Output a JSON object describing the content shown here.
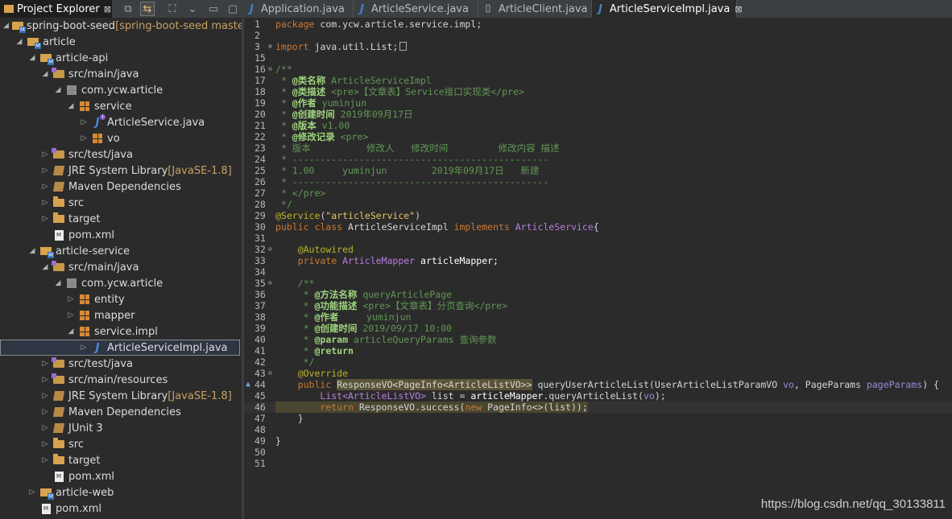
{
  "explorer": {
    "title": "Project Explorer",
    "close": "⊠"
  },
  "tabs": [
    {
      "label": "Application.java",
      "active": false
    },
    {
      "label": "ArticleService.java",
      "active": false
    },
    {
      "label": "ArticleClient.java",
      "active": false
    },
    {
      "label": "ArticleServiceImpl.java",
      "active": true
    }
  ],
  "tree": [
    {
      "label": "spring-boot-seed",
      "deco": " [spring-boot-seed master]"
    },
    {
      "label": "article"
    },
    {
      "label": "article-api"
    },
    {
      "label": "src/main/java"
    },
    {
      "label": "com.ycw.article"
    },
    {
      "label": "service"
    },
    {
      "label": "ArticleService.java"
    },
    {
      "label": "vo"
    },
    {
      "label": "src/test/java"
    },
    {
      "label": "JRE System Library",
      "deco": " [JavaSE-1.8]"
    },
    {
      "label": "Maven Dependencies"
    },
    {
      "label": "src"
    },
    {
      "label": "target"
    },
    {
      "label": "pom.xml"
    },
    {
      "label": "article-service"
    },
    {
      "label": "src/main/java"
    },
    {
      "label": "com.ycw.article"
    },
    {
      "label": "entity"
    },
    {
      "label": "mapper"
    },
    {
      "label": "service.impl"
    },
    {
      "label": "ArticleServiceImpl.java"
    },
    {
      "label": "src/test/java"
    },
    {
      "label": "src/main/resources"
    },
    {
      "label": "JRE System Library",
      "deco": " [JavaSE-1.8]"
    },
    {
      "label": "Maven Dependencies"
    },
    {
      "label": "JUnit 3"
    },
    {
      "label": "src"
    },
    {
      "label": "target"
    },
    {
      "label": "pom.xml"
    },
    {
      "label": "article-web"
    },
    {
      "label": "pom.xml"
    }
  ],
  "code": {
    "line_numbers": [
      "1",
      "2",
      "3",
      "15",
      "16",
      "17",
      "18",
      "19",
      "20",
      "21",
      "22",
      "23",
      "24",
      "25",
      "26",
      "27",
      "28",
      "29",
      "30",
      "31",
      "32",
      "33",
      "34",
      "35",
      "36",
      "37",
      "38",
      "39",
      "40",
      "41",
      "42",
      "43",
      "44",
      "45",
      "46",
      "47",
      "48",
      "49",
      "50",
      "51"
    ],
    "l1_kw": "package",
    "l1_rest": " com.ycw.article.service.impl;",
    "l3_kw": "import",
    "l3_rest": " java.util.List;",
    "l16": "/**",
    "l17_tag": "@类名称",
    "l17_val": " ArticleServiceImpl",
    "l18_tag": "@类描述",
    "l18_val": " <pre>【文章表】Service接口实现类</pre>",
    "l19_tag": "@作者",
    "l19_val": " yuminjun",
    "l20_tag": "@创建时间",
    "l20_val": " 2019年09月17日",
    "l21_tag": "@版本",
    "l21_val": " v1.00",
    "l22_tag": "@修改记录",
    "l22_val": " <pre>",
    "l23": " * 版本          修改人   修改时间         修改内容 描述",
    "l24": " * ----------------------------------------------",
    "l25": " * 1.00     yuminjun        2019年09月17日   新建",
    "l26": " * ----------------------------------------------",
    "l27": " * </pre>",
    "l28": " */",
    "l29_an": "@Service",
    "l29_paren_open": "(",
    "l29_str": "\"articleService\"",
    "l29_paren_close": ")",
    "l30_kw1": "public class",
    "l30_name": " ArticleServiceImpl ",
    "l30_kw2": "implements",
    "l30_type": " ArticleService",
    "l30_brace": "{",
    "l32_an": "@Autowired",
    "l33_kw": "private",
    "l33_type": " ArticleMapper",
    "l33_field": " articleMapper;",
    "l35": "/**",
    "l36_tag": "@方法名称",
    "l36_val": " queryArticlePage",
    "l37_tag": "@功能描述",
    "l37_val": " <pre>【文章表】分页查询</pre>",
    "l38_tag": "@作者",
    "l38_val": "     yuminjun",
    "l39_tag": "@创建时间",
    "l39_val": " 2019/09/17 10:00",
    "l40_tag": "@param",
    "l40_val": " articleQueryParams 查询参数",
    "l41_tag": "@return",
    "l42": " */",
    "l43_an": "@Override",
    "l44_kw": "public",
    "l44_ret": "ResponseVO<PageInfo<ArticleListVO>>",
    "l44_rest": " queryUserArticleList(UserArticleListParamVO ",
    "l44_p1": "vo",
    "l44_rest2": ", PageParams ",
    "l44_p2": "pageParams",
    "l44_end": ") {",
    "l45_type": "List<ArticleListVO>",
    "l45_rest": " list = ",
    "l45_field": "articleMapper",
    "l45_rest2": ".queryArticleList(",
    "l45_p": "vo",
    "l45_end": ");",
    "l46_kw": "return",
    "l46_rest": " ResponseVO.success(",
    "l46_kw2": "new",
    "l46_rest2": " PageInfo<>(list));",
    "l47": "}",
    "l49": "}"
  },
  "watermark": "https://blog.csdn.net/qq_30133811"
}
